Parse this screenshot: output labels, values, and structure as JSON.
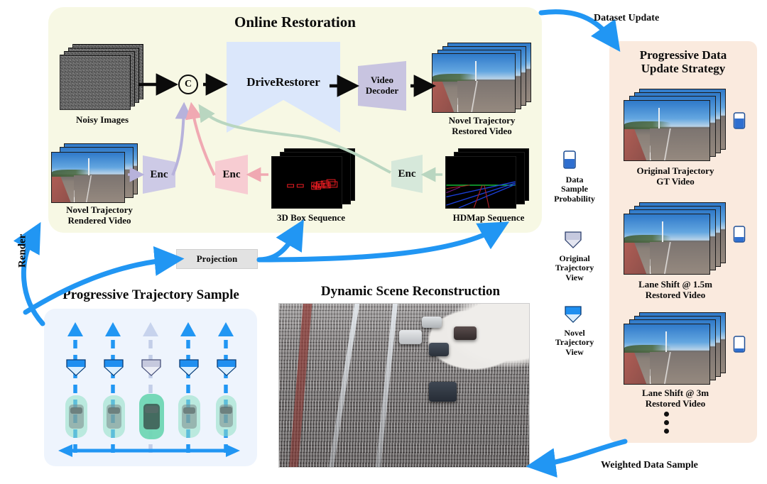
{
  "panels": {
    "online": {
      "title": "Online Restoration",
      "bg": "#f7f8e4"
    },
    "progressive_update": {
      "title": "Progressive Data\nUpdate Strategy",
      "bg": "#faeade"
    },
    "trajectory_sample": {
      "title": "Progressive Trajectory Sample",
      "bg": "#eef4fd"
    },
    "scene_reconstruction": {
      "title": "Dynamic Scene Reconstruction"
    }
  },
  "online": {
    "noisy_images_label": "Noisy Images",
    "concat_symbol": "C",
    "drive_restorer_label": "DriveRestorer",
    "video_decoder_label": "Video\nDecoder",
    "novel_restored_label": "Novel Trajectory\nRestored Video",
    "novel_rendered_label": "Novel Trajectory\nRendered Video",
    "box_sequence_label": "3D Box Sequence",
    "hdmap_sequence_label": "HDMap Sequence",
    "enc_label": "Enc",
    "encoders": [
      {
        "name": "enc-rendered-video",
        "label": "Enc",
        "color": "#cdcae6"
      },
      {
        "name": "enc-3dbox",
        "label": "Enc",
        "color": "#f7ccd2"
      },
      {
        "name": "enc-hdmap",
        "label": "Enc",
        "color": "#d6e8da"
      }
    ]
  },
  "projection": {
    "label": "Projection"
  },
  "arrow_labels": {
    "render": "Render",
    "dataset_update": "Dataset Update",
    "weighted_data_sample": "Weighted Data Sample"
  },
  "legend": {
    "items": [
      {
        "name": "data-sample-probability",
        "icon": "beaker-icon",
        "label": "Data\nSample\nProbability",
        "color": "#2f6fd0"
      },
      {
        "name": "original-trajectory-view",
        "icon": "camera-frustum-icon",
        "label": "Original\nTrajectory\nView",
        "color": "#c6c9de"
      },
      {
        "name": "novel-trajectory-view",
        "icon": "camera-frustum-icon",
        "label": "Novel\nTrajectory\nView",
        "color": "#1f8ff0"
      }
    ]
  },
  "progressive_update": {
    "entries": [
      {
        "name": "original-trajectory-gt-video",
        "label": "Original Trajectory\nGT Video",
        "fill_ratio": 0.55
      },
      {
        "name": "lane-shift-1p5m-restored-video",
        "label": "Lane Shift @ 1.5m\nRestored Video",
        "fill_ratio": 0.3
      },
      {
        "name": "lane-shift-3m-restored-video",
        "label": "Lane Shift @ 3m\nRestored Video",
        "fill_ratio": 0.22
      }
    ],
    "ellipsis": "•"
  },
  "trajectory_sample": {
    "lanes": [
      {
        "name": "lane-1",
        "state": "novel"
      },
      {
        "name": "lane-2",
        "state": "novel"
      },
      {
        "name": "lane-3",
        "state": "original"
      },
      {
        "name": "lane-4",
        "state": "novel"
      },
      {
        "name": "lane-5",
        "state": "novel"
      }
    ]
  },
  "colors": {
    "accent_blue": "#2196f3",
    "panel_online": "#f7f8e4",
    "panel_update": "#faeade",
    "panel_traj": "#eef4fd",
    "drive_restorer": "#dbe7fb",
    "video_decoder": "#c8c4e0",
    "projection_box": "#e2e2e2"
  }
}
